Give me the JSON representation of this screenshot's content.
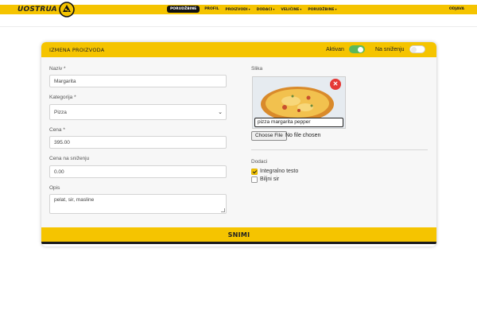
{
  "brand": {
    "name": "UOSTRUA"
  },
  "nav": {
    "items": [
      {
        "label": "PORUDŽBINE",
        "active": true,
        "dropdown": false
      },
      {
        "label": "PROFIL",
        "active": false,
        "dropdown": false
      },
      {
        "label": "PROIZVODI",
        "active": false,
        "dropdown": true
      },
      {
        "label": "DODACI",
        "active": false,
        "dropdown": true
      },
      {
        "label": "VELIČINE",
        "active": false,
        "dropdown": true
      },
      {
        "label": "PORUDŽBINE",
        "active": false,
        "dropdown": true
      }
    ],
    "login": "ODJAVA"
  },
  "form": {
    "title": "IZMENA PROIZVODA",
    "toggles": {
      "active": {
        "label": "Aktivan",
        "on": true
      },
      "sale": {
        "label": "Na sniženju",
        "on": false
      }
    },
    "fields": {
      "name": {
        "label": "Naziv *",
        "value": "Margarita"
      },
      "category": {
        "label": "Kategorija *",
        "value": "Pizza"
      },
      "price": {
        "label": "Cena *",
        "value": "395.00"
      },
      "sale_price": {
        "label": "Cena na sniženju",
        "value": "0.00"
      },
      "description": {
        "label": "Opis",
        "value": "pelat, sir, masline"
      }
    },
    "image": {
      "label": "Slika",
      "caption": "pizza margarita pepper",
      "remove_icon": "close-icon",
      "file_button": "Choose File",
      "file_status": "No file chosen"
    },
    "addons": {
      "label": "Dodaci",
      "items": [
        {
          "label": "Integralno testo",
          "checked": true
        },
        {
          "label": "Biljni sir",
          "checked": false
        }
      ]
    },
    "submit": "SNIMI"
  },
  "colors": {
    "accent": "#f5c400",
    "toggle_on": "#5cb85c",
    "danger": "#e53935"
  }
}
